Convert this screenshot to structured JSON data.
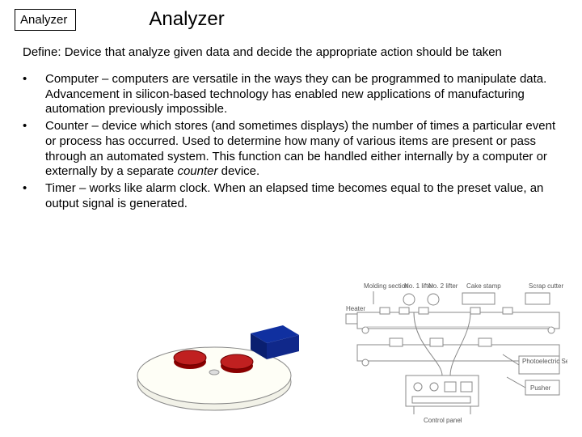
{
  "header": {
    "box_label": "Analyzer",
    "title": "Analyzer"
  },
  "definition": "Define: Device that analyze given data and decide the appropriate action should be taken",
  "bullets": [
    "Computer – computers are versatile in the ways they can be programmed to manipulate data. Advancement in silicon-based technology has enabled new applications of manufacturing automation previously impossible.",
    "Counter – device which stores (and sometimes displays) the number of times a particular event or process has occurred. Used to determine how many of various items are present or pass through an automated system. This function can be handled either internally by a computer or externally by a separate counter device.",
    "Timer – works like alarm clock. When an elapsed time becomes equal to the preset value, an output signal is generated."
  ],
  "fig_left_alt": "turntable-with-two-red-pucks-and-blue-block",
  "fig_right": {
    "alt": "line-diagram-of-automated-conveyor-system",
    "labels": {
      "molding": "Molding section",
      "no1": "No. 1 lifter",
      "no2": "No. 2 lifter",
      "cakestamp": "Cake stamp",
      "scrap": "Scrap cutter",
      "heater": "Heater",
      "photo": "Photoelectric Sensor",
      "pusher": "Pusher",
      "panel": "Control panel"
    }
  }
}
